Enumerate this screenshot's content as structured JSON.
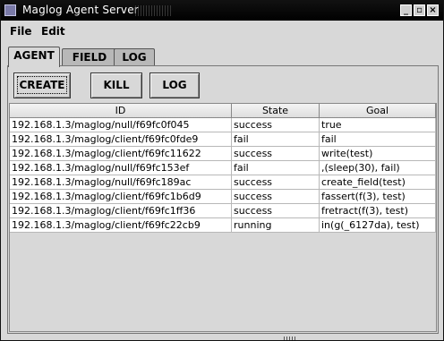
{
  "window": {
    "title": "Maglog Agent Server"
  },
  "menus": [
    {
      "label": "File"
    },
    {
      "label": "Edit"
    }
  ],
  "tabs": [
    {
      "label": "AGENT"
    },
    {
      "label": "FIELD"
    },
    {
      "label": "LOG"
    }
  ],
  "toolbar": {
    "create_label": "CREATE",
    "kill_label": "KILL",
    "log_label": "LOG"
  },
  "table": {
    "columns": [
      "ID",
      "State",
      "Goal"
    ],
    "rows": [
      [
        "192.168.1.3/maglog/null/f69fc0f045",
        "success",
        "true"
      ],
      [
        "192.168.1.3/maglog/client/f69fc0fde9",
        "fail",
        "fail"
      ],
      [
        "192.168.1.3/maglog/client/f69fc11622",
        "success",
        "write(test)"
      ],
      [
        "192.168.1.3/maglog/null/f69fc153ef",
        "fail",
        ",(sleep(30), fail)"
      ],
      [
        "192.168.1.3/maglog/null/f69fc189ac",
        "success",
        "create_field(test)"
      ],
      [
        "192.168.1.3/maglog/client/f69fc1b6d9",
        "success",
        "fassert(f(3), test)"
      ],
      [
        "192.168.1.3/maglog/client/f69fc1ff36",
        "success",
        "fretract(f(3), test)"
      ],
      [
        "192.168.1.3/maglog/client/f69fc22cb9",
        "running",
        "in(g(_6127da), test)"
      ]
    ]
  }
}
